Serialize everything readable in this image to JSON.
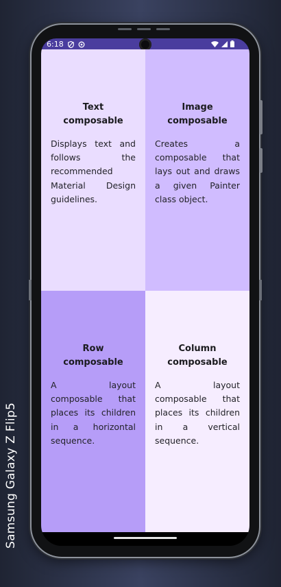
{
  "device": {
    "label": "Samsung Galaxy  Z  Flip5"
  },
  "status_bar": {
    "time": "6:18",
    "left_icons": [
      "shield-icon",
      "sync-icon"
    ],
    "right_icons": [
      "wifi-icon",
      "signal-icon",
      "battery-icon"
    ],
    "color": "#4a3d9e"
  },
  "cards": [
    {
      "title": "Text composable",
      "body": "Displays text and follows the recommended Material Design guidelines.",
      "background": "#eaddff"
    },
    {
      "title": "Image composable",
      "body": "Creates a composable that lays out and draws a given Painter class object.",
      "background": "#d0bcff"
    },
    {
      "title": "Row composable",
      "body": "A layout composable that places its children in a horizontal sequence.",
      "background": "#b69df8"
    },
    {
      "title": "Column composable",
      "body": "A layout composable that places its children in a vertical sequence.",
      "background": "#f6edff"
    }
  ]
}
